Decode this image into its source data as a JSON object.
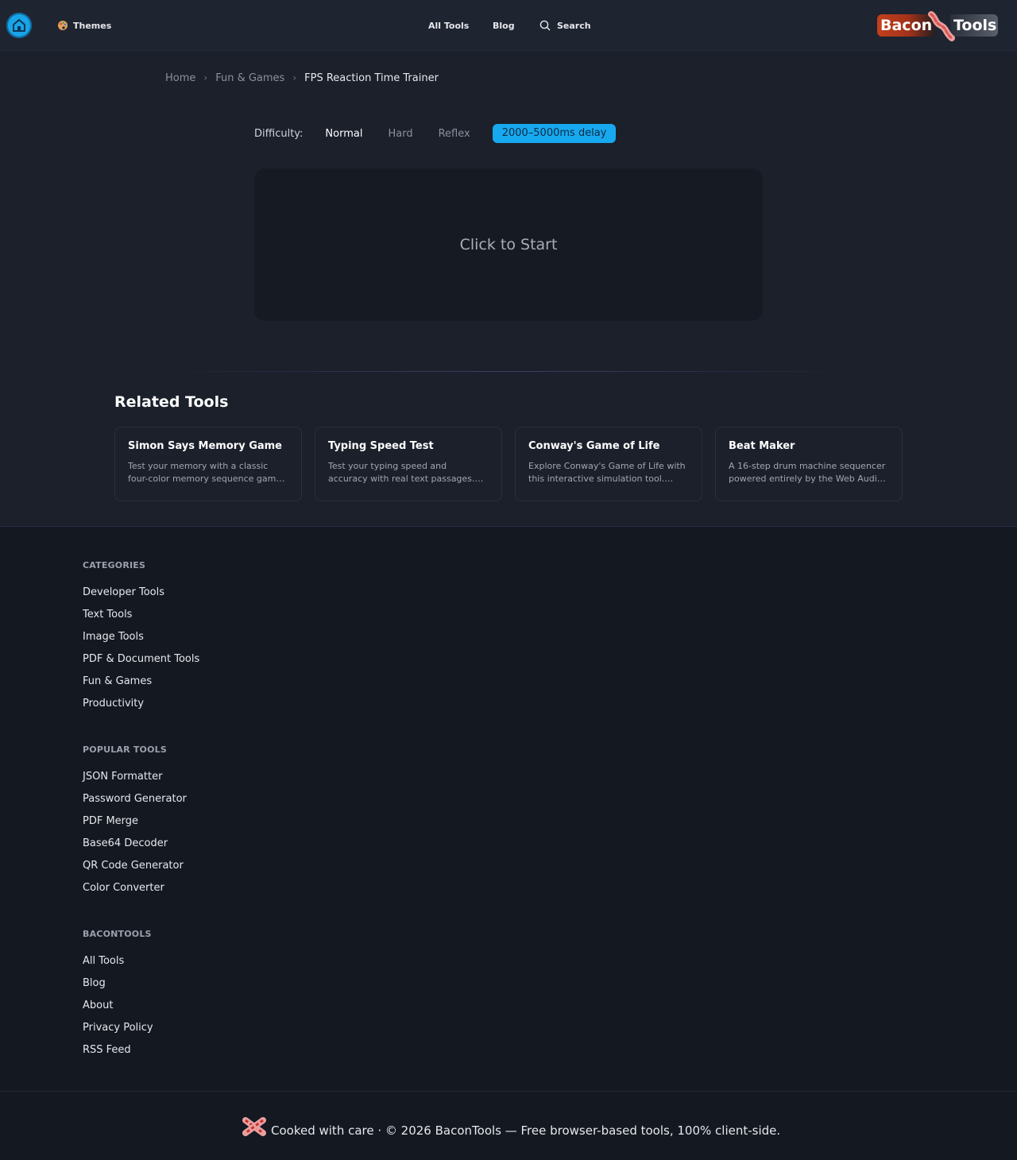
{
  "header": {
    "themes_label": "Themes",
    "nav_all_tools": "All Tools",
    "nav_blog": "Blog",
    "nav_search": "Search",
    "logo_left": "Bacon",
    "logo_right": "Tools"
  },
  "breadcrumb": {
    "home": "Home",
    "category": "Fun & Games",
    "current": "FPS Reaction Time Trainer"
  },
  "difficulty": {
    "label": "Difficulty:",
    "options": [
      "Normal",
      "Hard",
      "Reflex"
    ],
    "selected": "Normal",
    "delay_badge": "2000–5000ms delay"
  },
  "game": {
    "prompt": "Click to Start"
  },
  "related": {
    "title": "Related Tools",
    "cards": [
      {
        "title": "Simon Says Memory Game",
        "desc": "Test your memory with a classic four-color memory sequence gam…"
      },
      {
        "title": "Typing Speed Test",
        "desc": "Test your typing speed and accuracy with real text passages.…"
      },
      {
        "title": "Conway's Game of Life",
        "desc": "Explore Conway's Game of Life with this interactive simulation tool.…"
      },
      {
        "title": "Beat Maker",
        "desc": "A 16-step drum machine sequencer powered entirely by the Web Audi…"
      }
    ]
  },
  "footer": {
    "categories": {
      "heading": "CATEGORIES",
      "links": [
        "Developer Tools",
        "Text Tools",
        "Image Tools",
        "PDF & Document Tools",
        "Fun & Games",
        "Productivity"
      ]
    },
    "popular": {
      "heading": "POPULAR TOOLS",
      "links": [
        "JSON Formatter",
        "Password Generator",
        "PDF Merge",
        "Base64 Decoder",
        "QR Code Generator",
        "Color Converter"
      ]
    },
    "bacontools": {
      "heading": "BACONTOOLS",
      "links": [
        "All Tools",
        "Blog",
        "About",
        "Privacy Policy",
        "RSS Feed"
      ]
    },
    "copyright": "Cooked with care · © 2026 BaconTools — Free browser-based tools, 100% client-side."
  },
  "colors": {
    "accent": "#17a9ef",
    "background": "#1b202b",
    "footer_bg": "#141821",
    "brand_bacon": "#c4401c"
  },
  "icons": {
    "home": "home-icon",
    "themes": "palette-icon",
    "search": "search-icon",
    "breadcrumb_sep": "chevron-right-icon",
    "logo": "bacon-strip-icon"
  }
}
